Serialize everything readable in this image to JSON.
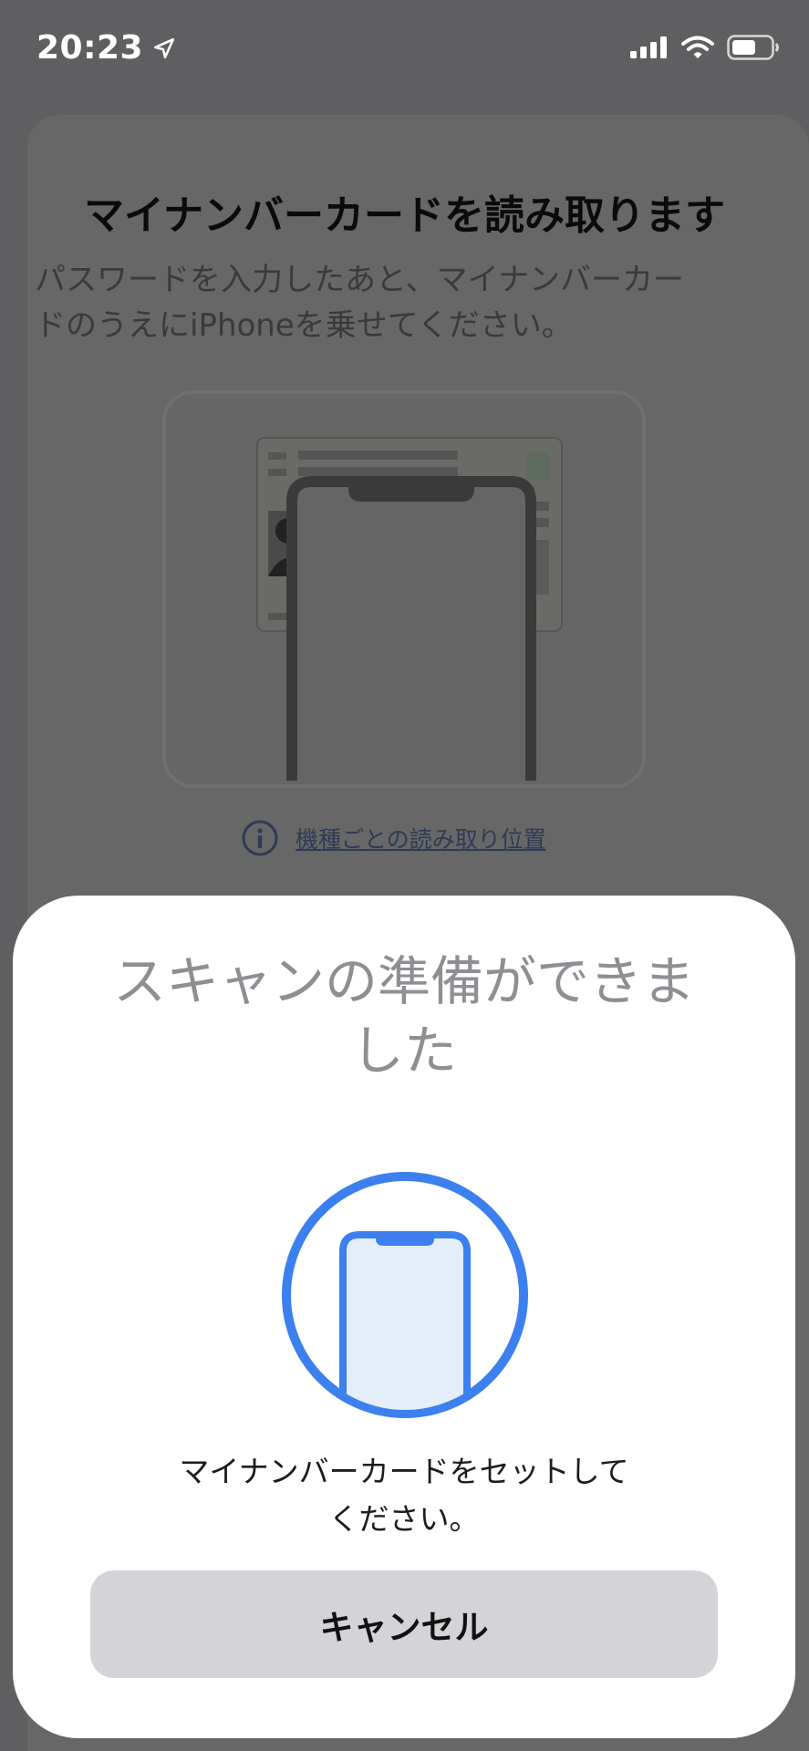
{
  "status_bar": {
    "time": "20:23",
    "icons": [
      "location-arrow-icon",
      "cellular-signal-icon",
      "wifi-icon",
      "battery-icon"
    ]
  },
  "background_screen": {
    "title": "マイナンバーカードを読み取ります",
    "description_line1": "パスワードを入力したあと、マイナンバーカー",
    "description_line2": "ドのうえにiPhoneを乗せてください。",
    "illustration_icon": "iphone-on-card-illustration",
    "info_icon": "info-circle-icon",
    "info_link": "機種ごとの読み取り位置"
  },
  "scan_sheet": {
    "title_line1": "スキャンの準備ができま",
    "title_line2": "した",
    "icon": "phone-nfc-icon",
    "message_line1": "マイナンバーカードをセットして",
    "message_line2": "ください。",
    "cancel_label": "キャンセル",
    "accent_color": "#3b80ee"
  }
}
